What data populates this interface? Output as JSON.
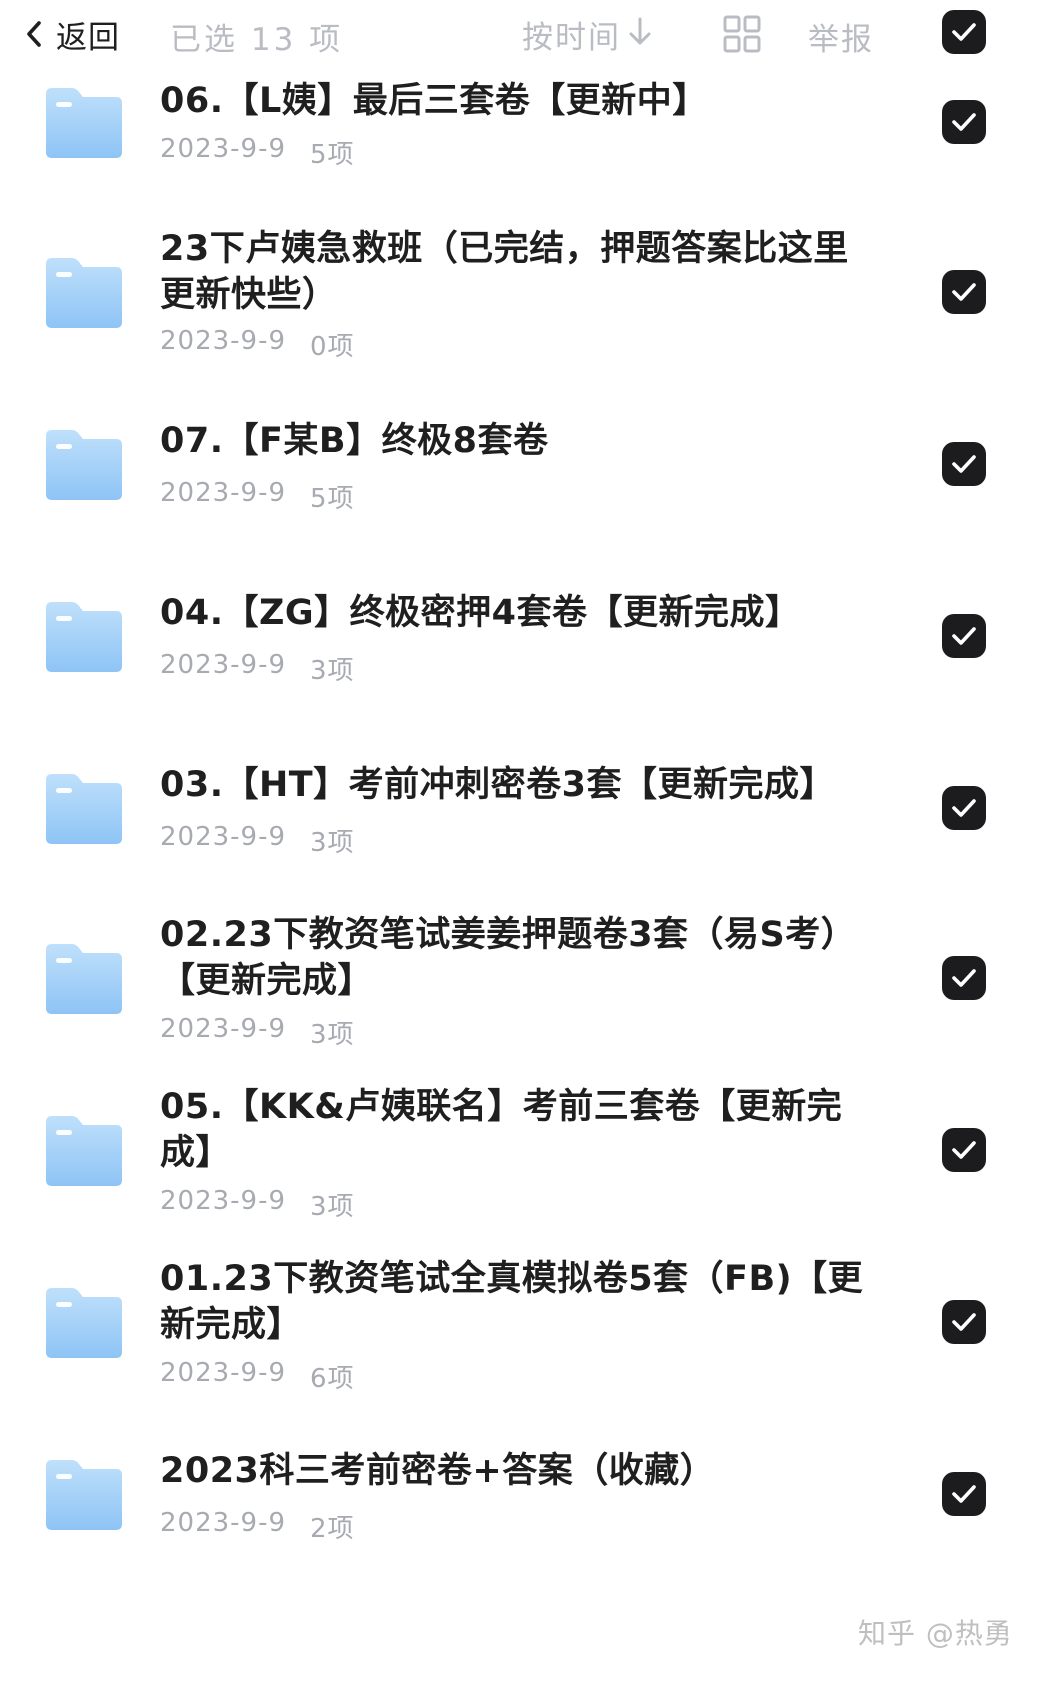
{
  "header": {
    "back_label": "返回",
    "selected_text": "已选 13 项",
    "sort_label": "按时间",
    "report_label": "举报",
    "select_all_checked": true
  },
  "items": [
    {
      "title": "06.【L姨】最后三套卷【更新中】",
      "date": "2023-9-9",
      "count": "5项",
      "checked": true
    },
    {
      "title": "23下卢姨急救班（已完结，押题答案比这里更新快些）",
      "date": "2023-9-9",
      "count": "0项",
      "checked": true
    },
    {
      "title": "07.【F某B】终极8套卷",
      "date": "2023-9-9",
      "count": "5项",
      "checked": true
    },
    {
      "title": "04.【ZG】终极密押4套卷【更新完成】",
      "date": "2023-9-9",
      "count": "3项",
      "checked": true
    },
    {
      "title": "03.【HT】考前冲刺密卷3套【更新完成】",
      "date": "2023-9-9",
      "count": "3项",
      "checked": true
    },
    {
      "title": "02.23下教资笔试姜姜押题卷3套（易S考）【更新完成】",
      "date": "2023-9-9",
      "count": "3项",
      "checked": true
    },
    {
      "title": "05.【KK&卢姨联名】考前三套卷【更新完成】",
      "date": "2023-9-9",
      "count": "3项",
      "checked": true
    },
    {
      "title": "01.23下教资笔试全真模拟卷5套（FB)【更新完成】",
      "date": "2023-9-9",
      "count": "6项",
      "checked": true
    },
    {
      "title": "2023科三考前密卷+答案（收藏）",
      "date": "2023-9-9",
      "count": "2项",
      "checked": true
    }
  ],
  "watermark": "知乎 @热勇",
  "colors": {
    "folder_top": "#bfe0fb",
    "folder_bottom": "#8ec4f5",
    "checkbox_bg": "#1c1c1e",
    "muted_text": "#b9bcc2"
  },
  "icons": {
    "back": "chevron-left-icon",
    "sort": "arrow-down-icon",
    "grid": "grid-view-icon",
    "folder": "folder-icon",
    "check": "checkmark-icon"
  }
}
